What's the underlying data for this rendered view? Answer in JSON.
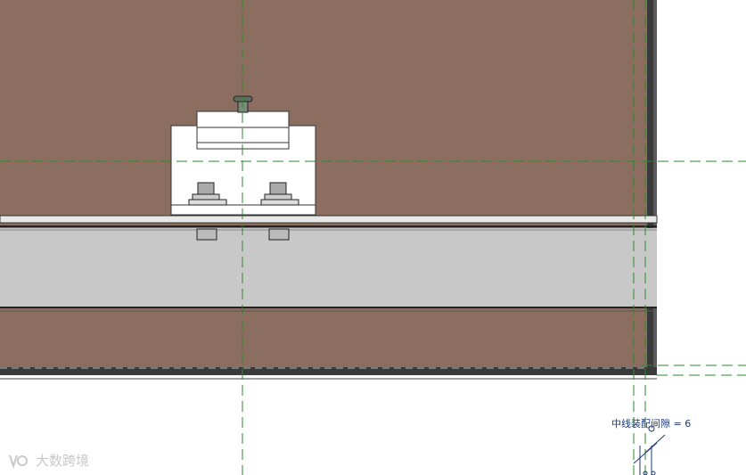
{
  "annotation": {
    "label": "中线装配间隙",
    "equals": "=",
    "value": "6"
  },
  "watermark": {
    "text": "大数跨境"
  },
  "colors": {
    "panel": "#8c6e60",
    "rail": "#c8c8c8",
    "centerline": "#2a8a2a",
    "annotation": "#1e3a78",
    "edge": "#333333"
  }
}
